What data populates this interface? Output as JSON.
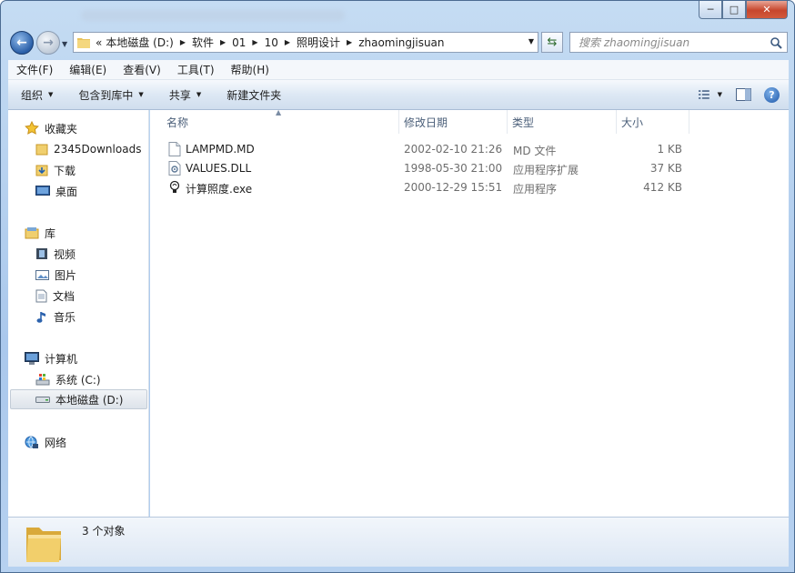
{
  "window": {
    "title": "",
    "controls": {
      "minimize": "─",
      "maximize": "□",
      "close": "✕"
    }
  },
  "address": {
    "overflow": "«",
    "crumbs": [
      "本地磁盘 (D:)",
      "软件",
      "01",
      "10",
      "照明设计",
      "zhaomingjisuan"
    ]
  },
  "search": {
    "placeholder": "搜索 zhaomingjisuan"
  },
  "menubar": {
    "items": [
      "文件(F)",
      "编辑(E)",
      "查看(V)",
      "工具(T)",
      "帮助(H)"
    ]
  },
  "toolbar": {
    "organize": "组织",
    "include_in_library": "包含到库中",
    "share": "共享",
    "new_folder": "新建文件夹"
  },
  "navigation": {
    "favorites": "收藏夹",
    "favorites_items": [
      "2345Downloads",
      "下载",
      "桌面"
    ],
    "libraries": "库",
    "libraries_items": [
      "视频",
      "图片",
      "文档",
      "音乐"
    ],
    "computer": "计算机",
    "computer_items": [
      "系统 (C:)",
      "本地磁盘 (D:)"
    ],
    "network": "网络",
    "selected": "本地磁盘 (D:)"
  },
  "columns": {
    "name": "名称",
    "date": "修改日期",
    "type": "类型",
    "size": "大小"
  },
  "files": [
    {
      "name": "LAMPMD.MD",
      "date": "2002-02-10 21:26",
      "type": "MD 文件",
      "size": "1 KB",
      "icon": "generic-file-icon"
    },
    {
      "name": "VALUES.DLL",
      "date": "1998-05-30 21:00",
      "type": "应用程序扩展",
      "size": "37 KB",
      "icon": "dll-file-icon"
    },
    {
      "name": "计算照度.exe",
      "date": "2000-12-29 15:51",
      "type": "应用程序",
      "size": "412 KB",
      "icon": "lamp-exe-icon"
    }
  ],
  "status": {
    "count": "3 个对象"
  },
  "colors": {
    "accent": "#3b6fb5",
    "toolbar": "#dde8f4",
    "close": "#c7462d"
  }
}
